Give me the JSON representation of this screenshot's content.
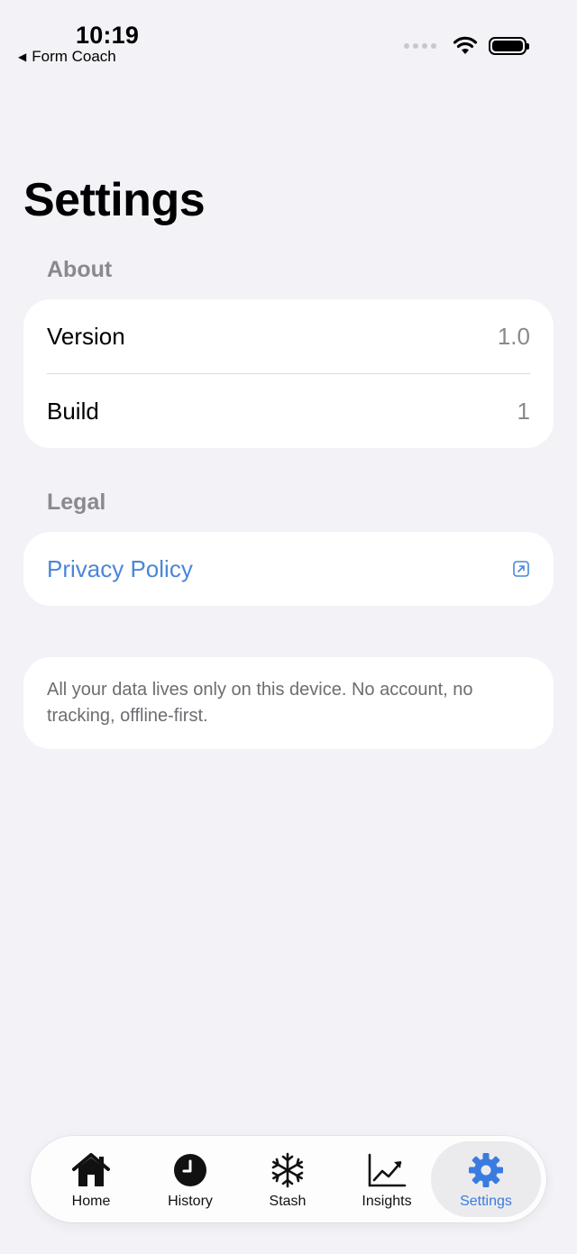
{
  "status_bar": {
    "time": "10:19",
    "back_label": "Form Coach",
    "back_icon": "triangle-left-icon"
  },
  "page": {
    "title": "Settings"
  },
  "sections": {
    "about": {
      "header": "About",
      "rows": [
        {
          "label": "Version",
          "value": "1.0"
        },
        {
          "label": "Build",
          "value": "1"
        }
      ]
    },
    "legal": {
      "header": "Legal",
      "privacy_label": "Privacy Policy",
      "privacy_icon": "external-link-icon"
    },
    "note": "All your data lives only on this device. No account, no tracking, offline-first."
  },
  "tabbar": {
    "tabs": [
      {
        "label": "Home",
        "icon": "house-icon"
      },
      {
        "label": "History",
        "icon": "clock-icon"
      },
      {
        "label": "Stash",
        "icon": "snowflake-icon"
      },
      {
        "label": "Insights",
        "icon": "chart-trend-icon"
      },
      {
        "label": "Settings",
        "icon": "gear-icon",
        "active": true
      }
    ]
  },
  "colors": {
    "background": "#f2f2f7",
    "accent": "#4a86d8",
    "secondary_text": "#8a8a8e"
  }
}
